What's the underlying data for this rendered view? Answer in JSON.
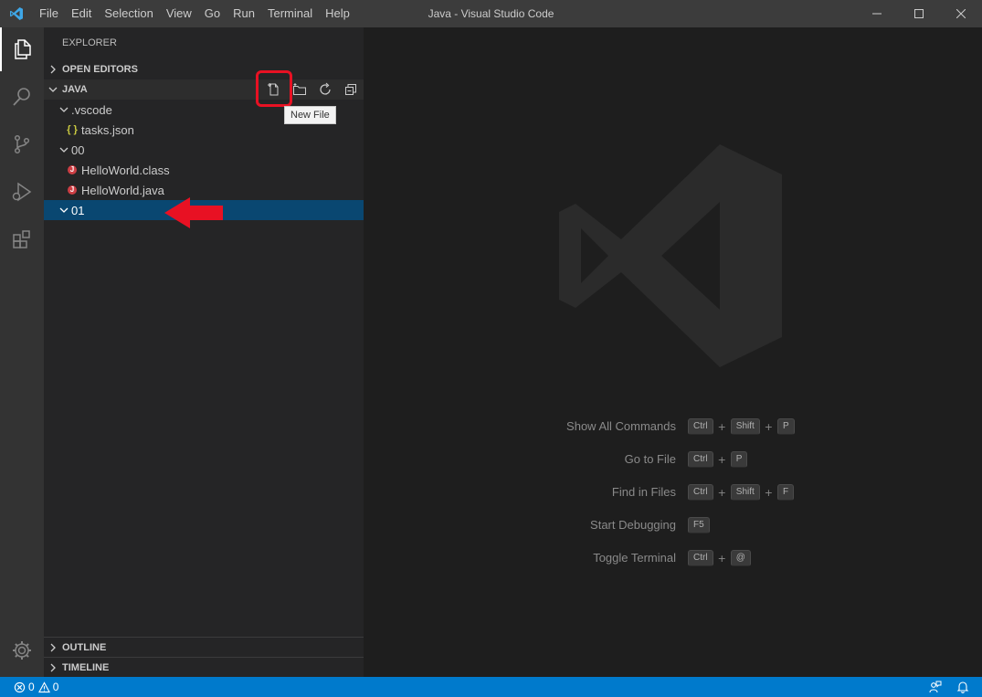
{
  "window": {
    "title": "Java - Visual Studio Code"
  },
  "menu": [
    "File",
    "Edit",
    "Selection",
    "View",
    "Go",
    "Run",
    "Terminal",
    "Help"
  ],
  "sidebar": {
    "title": "EXPLORER",
    "open_editors": "OPEN EDITORS",
    "folder": "JAVA",
    "outline": "OUTLINE",
    "timeline": "TIMELINE",
    "tree": [
      {
        "label": ".vscode",
        "type": "folder",
        "depth": 1,
        "expanded": true
      },
      {
        "label": "tasks.json",
        "type": "json",
        "depth": 2
      },
      {
        "label": "00",
        "type": "folder",
        "depth": 1,
        "expanded": true
      },
      {
        "label": "HelloWorld.class",
        "type": "java",
        "depth": 2
      },
      {
        "label": "HelloWorld.java",
        "type": "java",
        "depth": 2
      },
      {
        "label": "01",
        "type": "folder",
        "depth": 1,
        "expanded": true,
        "selected": true
      }
    ],
    "tooltip": "New File"
  },
  "editor": {
    "shortcuts": [
      {
        "label": "Show All Commands",
        "keys": [
          "Ctrl",
          "Shift",
          "P"
        ]
      },
      {
        "label": "Go to File",
        "keys": [
          "Ctrl",
          "P"
        ]
      },
      {
        "label": "Find in Files",
        "keys": [
          "Ctrl",
          "Shift",
          "F"
        ]
      },
      {
        "label": "Start Debugging",
        "keys": [
          "F5"
        ]
      },
      {
        "label": "Toggle Terminal",
        "keys": [
          "Ctrl",
          "@"
        ]
      }
    ]
  },
  "status": {
    "errors": "0",
    "warnings": "0"
  },
  "colors": {
    "accent": "#007acc",
    "selection": "#094771",
    "annotation": "#e81123"
  }
}
